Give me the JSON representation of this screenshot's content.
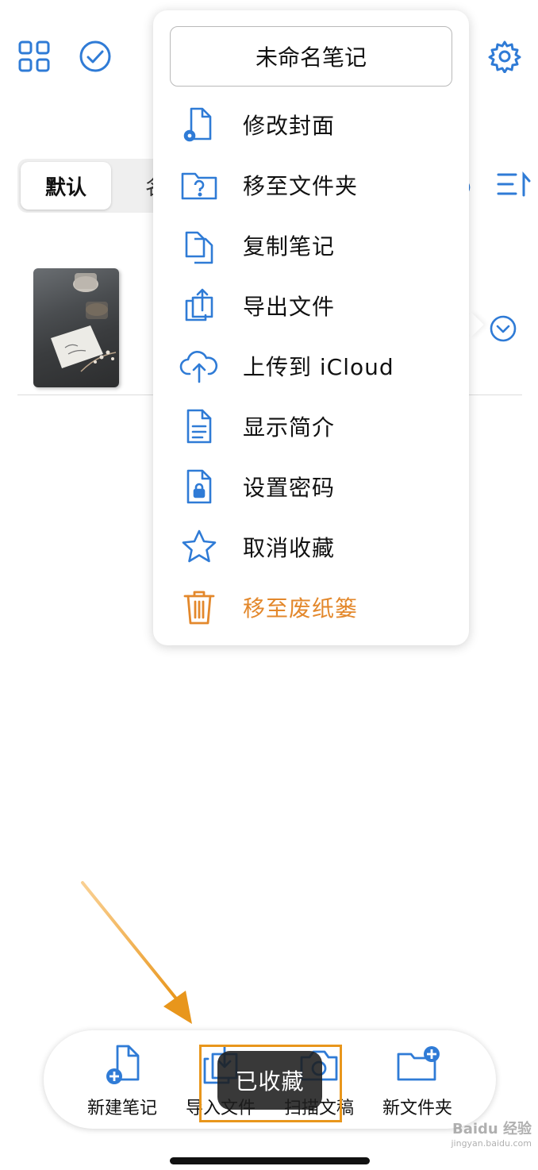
{
  "segments": {
    "active": "默认",
    "other": "名"
  },
  "menu": {
    "title": "未命名笔记",
    "items": [
      {
        "label": "修改封面",
        "icon": "doc-gear-icon"
      },
      {
        "label": "移至文件夹",
        "icon": "folder-question-icon"
      },
      {
        "label": "复制笔记",
        "icon": "copy-doc-icon"
      },
      {
        "label": "导出文件",
        "icon": "share-icon"
      },
      {
        "label": "上传到 iCloud",
        "icon": "cloud-upload-icon"
      },
      {
        "label": "显示简介",
        "icon": "doc-text-icon"
      },
      {
        "label": "设置密码",
        "icon": "doc-lock-icon"
      },
      {
        "label": "取消收藏",
        "icon": "star-icon"
      },
      {
        "label": "移至废纸篓",
        "icon": "trash-icon",
        "color": "#e3882c"
      }
    ]
  },
  "bottombar": {
    "items": [
      {
        "label": "新建笔记",
        "icon": "new-note-icon"
      },
      {
        "label": "导入文件",
        "icon": "import-icon"
      },
      {
        "label": "扫描文稿",
        "icon": "camera-icon"
      },
      {
        "label": "新文件夹",
        "icon": "new-folder-icon"
      }
    ]
  },
  "toast": "已收藏",
  "watermark": {
    "brand": "Baidu 经验",
    "url": "jingyan.baidu.com"
  },
  "colors": {
    "accent": "#2f7bd6",
    "danger": "#e3882c",
    "annotation": "#e8961c"
  }
}
